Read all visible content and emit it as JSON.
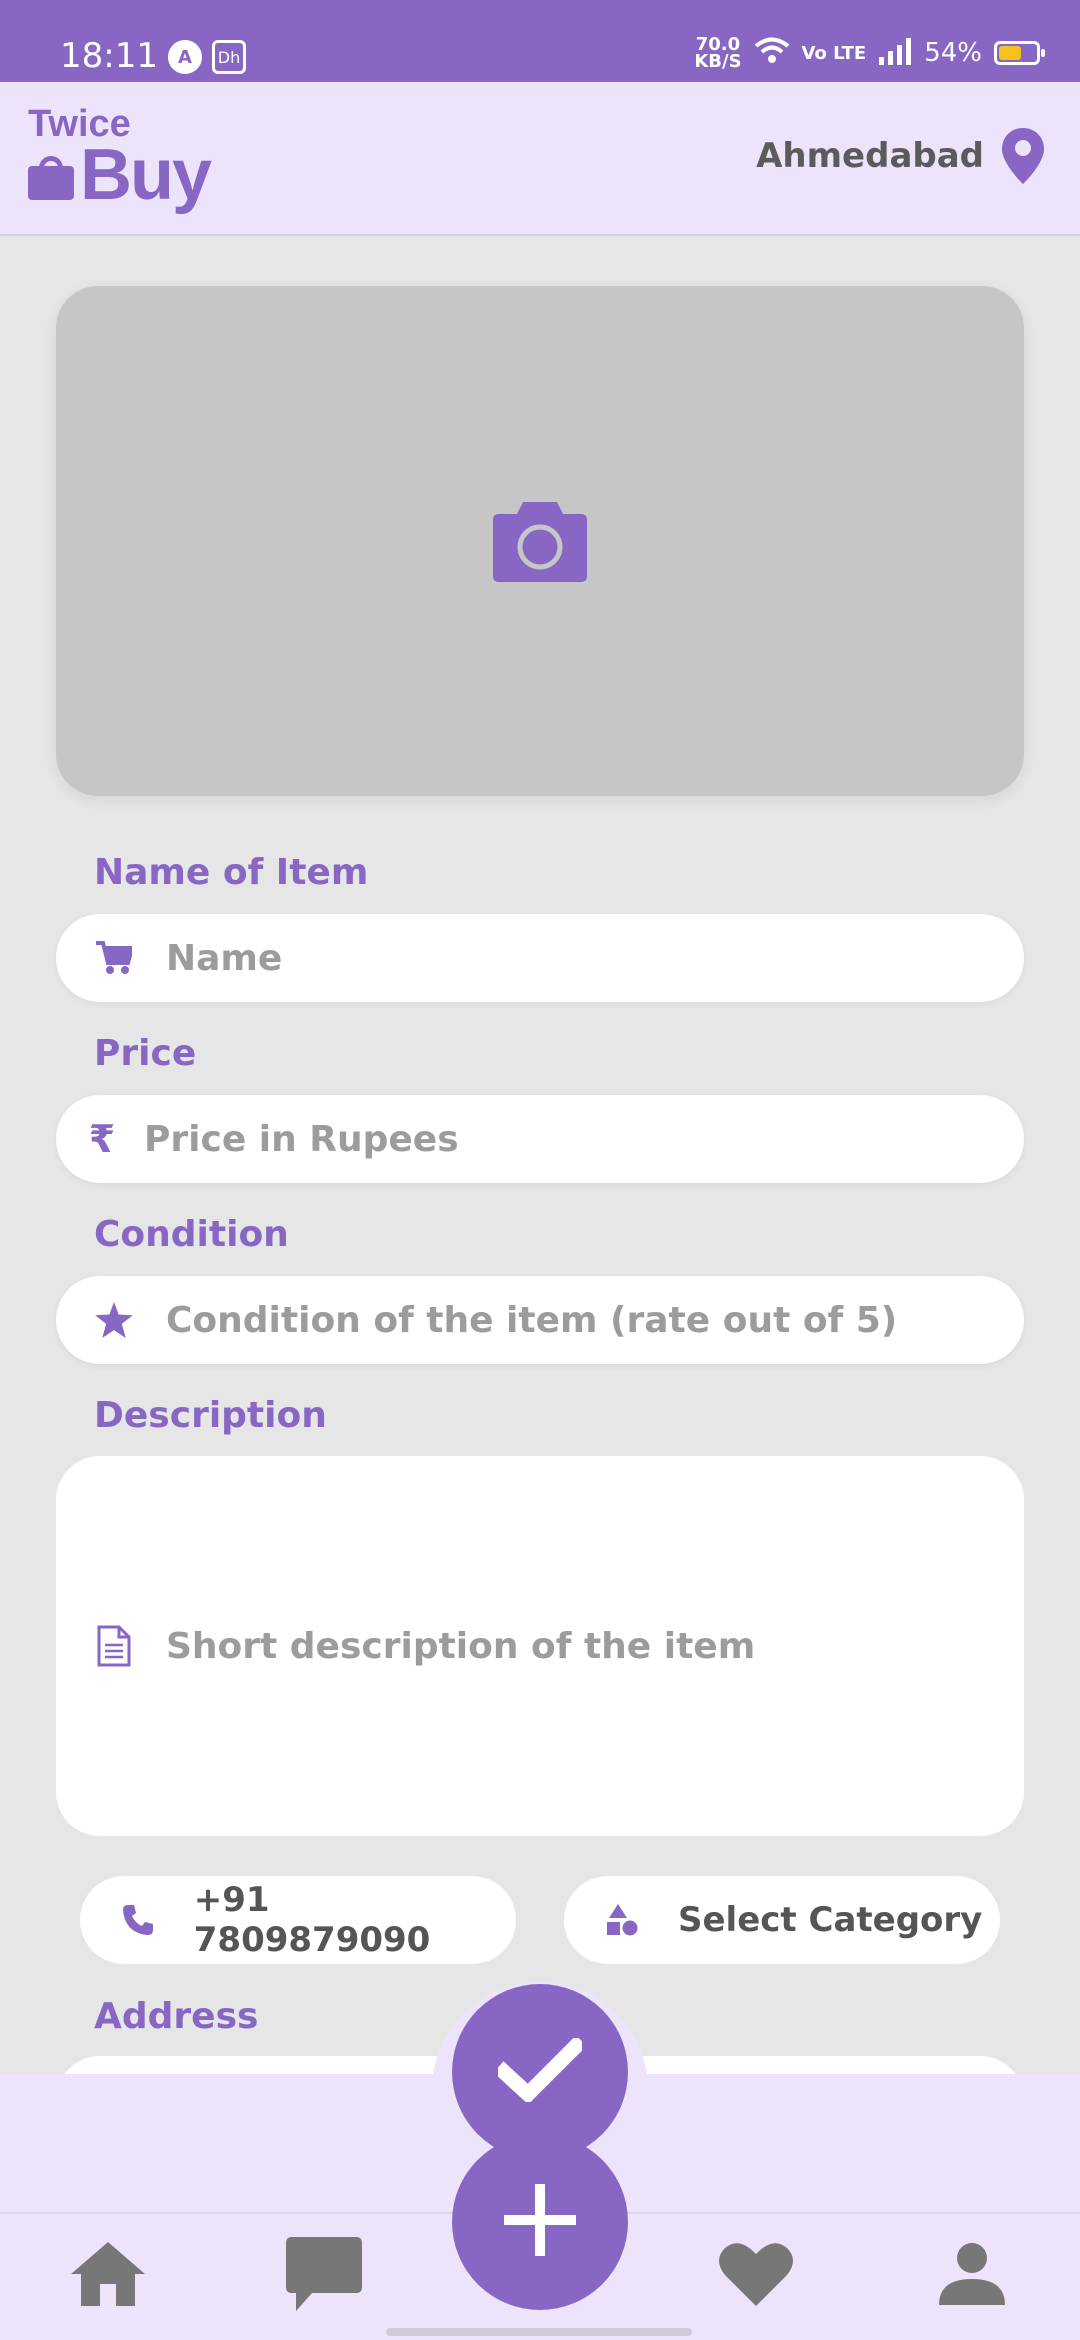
{
  "status_bar": {
    "time": "18:11",
    "notification_icons": [
      "A",
      "Dh"
    ],
    "net_speed_value": "70.0",
    "net_speed_unit": "KB/S",
    "volte": "Vo LTE",
    "battery_percent": "54%",
    "battery_level": 0.54
  },
  "header": {
    "logo_line1": "Twice",
    "logo_line2": "Buy",
    "location": "Ahmedabad"
  },
  "form": {
    "photo_icon": "camera-icon",
    "name_label": "Name of Item",
    "name_placeholder": "Name",
    "price_label": "Price",
    "price_currency_symbol": "₹",
    "price_placeholder": "Price in Rupees",
    "condition_label": "Condition",
    "condition_placeholder": "Condition of the item (rate out of 5)",
    "description_label": "Description",
    "description_placeholder": "Short description of the item",
    "phone": "+91 7809879090",
    "category": "Select Category",
    "address_label": "Address"
  },
  "actions": {
    "submit_icon": "check-icon",
    "add_icon": "plus-icon"
  },
  "bottom_nav": [
    "home-icon",
    "chat-icon",
    "heart-icon",
    "profile-icon"
  ],
  "colors": {
    "accent": "#8866c4",
    "header_bg": "#ede4fc",
    "page_bg": "#e6e6e6",
    "photo_bg": "#c6c6c6"
  }
}
